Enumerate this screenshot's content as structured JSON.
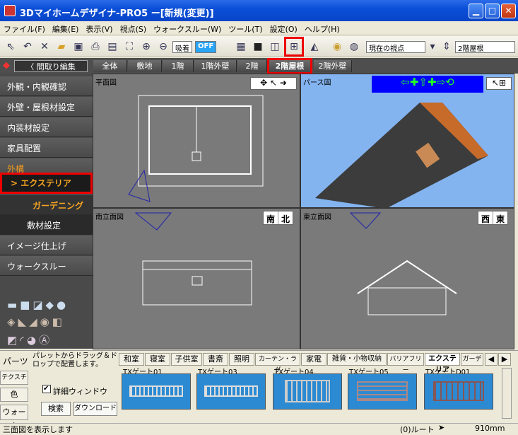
{
  "window": {
    "title": "3Dマイホームデザイナ-PRO5 ー[新規(変更)]"
  },
  "menu": [
    "ファイル(F)",
    "編集(E)",
    "表示(V)",
    "視点(S)",
    "ウォークスルー(W)",
    "ツール(T)",
    "設定(O)",
    "ヘルプ(H)"
  ],
  "toolbar": {
    "snap_label": "吸着",
    "snap_state": "OFF",
    "viewpoint": "現在の視点",
    "floor": "2階屋根"
  },
  "tabs": {
    "back": "間取り編集",
    "items": [
      "全体",
      "敷地",
      "1階",
      "1階外壁",
      "2階",
      "2階屋根",
      "2階外壁"
    ],
    "selected": "2階屋根"
  },
  "sidebar": {
    "items": [
      "外観・内観確認",
      "外壁・屋根材設定",
      "内装材設定",
      "家具配置",
      "外構",
      "エクステリア",
      "ガーデニング",
      "敷材設定",
      "イメージ仕上げ",
      "ウォークスルー"
    ],
    "active": "エクステリア"
  },
  "panes": {
    "plan": "平面図",
    "perspective": "パース図",
    "south": "南立面図",
    "east": "東立面図",
    "south_dirs": [
      "南",
      "北"
    ],
    "east_dirs": [
      "西",
      "東"
    ]
  },
  "bottom": {
    "parts_label": "パーツ",
    "texture_label": "テクスチャ",
    "color_label": "色",
    "walk_label": "ウォーク",
    "hint": "パレットからドラッグ＆ドロップで配置します。",
    "detail_checkbox": "詳細ウィンドウ",
    "search_button": "検索",
    "download_button": "ダウンロード",
    "categories": [
      "和室",
      "寝室",
      "子供室",
      "書斎",
      "照明",
      "カーテン・ラグ",
      "家電",
      "雑貨・小物収納",
      "バリアフリー",
      "エクステリア",
      "ガーデン"
    ],
    "selected_category": "エクステリア",
    "thumbs": [
      "TXゲート01",
      "TXゲート03",
      "TXゲート04",
      "TXゲート05",
      "TXゲートD01"
    ]
  },
  "status": {
    "message": "三面図を表示します",
    "route": "(0)ルート",
    "scale": "910mm"
  },
  "colors": {
    "title_blue": "#0a4fd8",
    "accent_red": "#e00000",
    "sidebar_orange": "#f39b1e",
    "sky": "#84b4f0"
  }
}
